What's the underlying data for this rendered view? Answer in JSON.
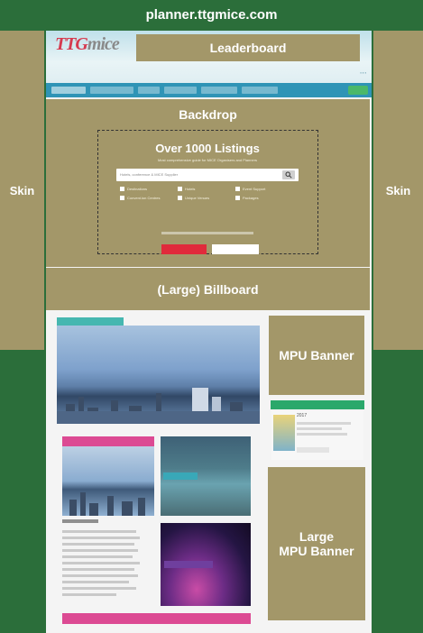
{
  "domain_bar": {
    "text": "planner.ttgmice.com"
  },
  "ad_slots": {
    "skin_left": "Skin",
    "skin_right": "Skin",
    "leaderboard": "Leaderboard",
    "backdrop": "Backdrop",
    "billboard": "(Large) Billboard",
    "mpu": "MPU Banner",
    "large_mpu_line1": "Large",
    "large_mpu_line2": "MPU Banner"
  },
  "site": {
    "logo_ttg": "TTG",
    "logo_mice": "mice",
    "listing_title": "Over 1000 Listings",
    "listing_subtitle": "Most comprehensive guide for MICE Organisers and Planners",
    "search_placeholder": "Hotels, conference & MICE Supplier",
    "event_year": "2017",
    "categories": [
      "Destinations",
      "Hotels",
      "Event Support",
      "Convent.ion Centres",
      "Unique Venues",
      "Packages"
    ]
  },
  "colors": {
    "background": "#2b6e3a",
    "ad_slot": "#a39769",
    "nav": "#2f94b6",
    "accent_red": "#e02a3b",
    "accent_pink": "#dc4a93",
    "accent_teal": "#46b7b0"
  }
}
